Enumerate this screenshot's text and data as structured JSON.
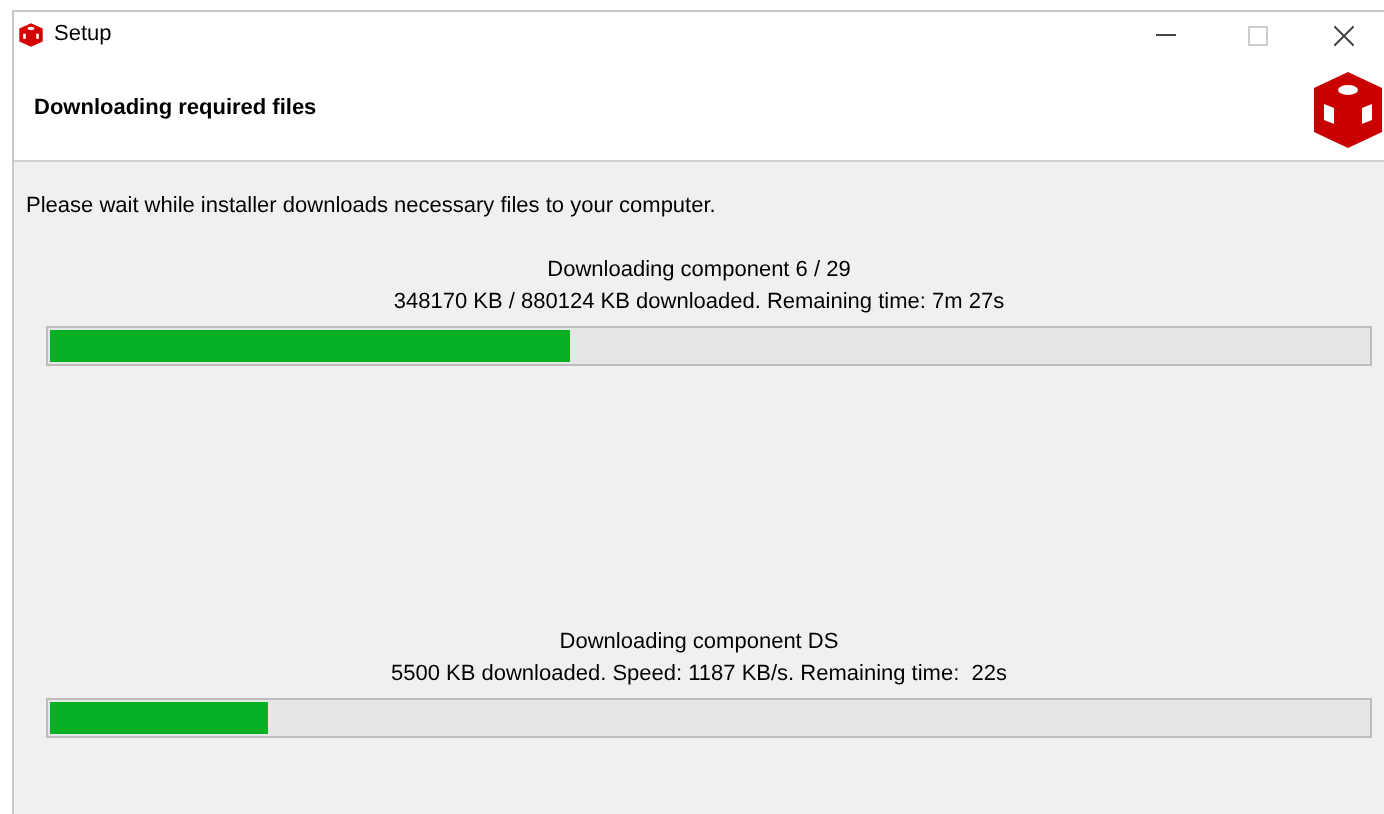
{
  "window": {
    "title": "Setup"
  },
  "header": {
    "title": "Downloading required files"
  },
  "message": "Please wait while installer downloads necessary files to your computer.",
  "progress": [
    {
      "title": "Downloading component 6 / 29",
      "detail": "348170 KB / 880124 KB downloaded. Remaining time: 7m 27s",
      "level": 0.395
    },
    {
      "title": "Downloading component DS",
      "detail": "5500 KB downloaded. Speed: 1187 KB/s. Remaining time:  22s",
      "level": 0.166
    }
  ]
}
